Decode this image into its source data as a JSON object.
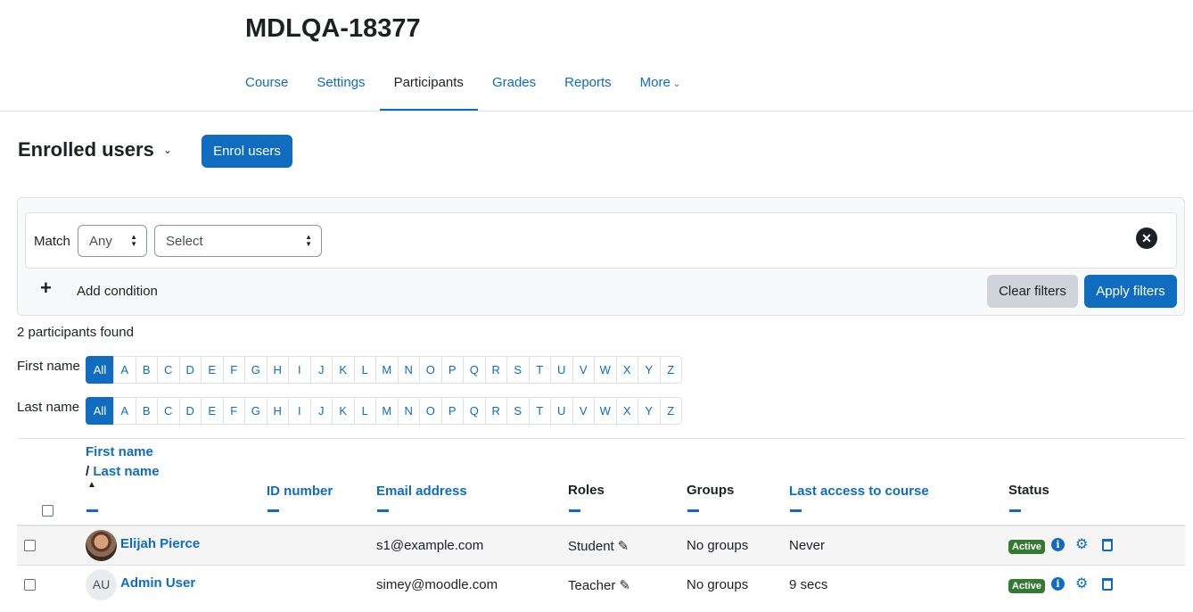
{
  "course": {
    "title": "MDLQA-18377"
  },
  "tabs": [
    {
      "label": "Course"
    },
    {
      "label": "Settings"
    },
    {
      "label": "Participants"
    },
    {
      "label": "Grades"
    },
    {
      "label": "Reports"
    },
    {
      "label": "More"
    }
  ],
  "page": {
    "heading": "Enrolled users",
    "enrol_button": "Enrol users",
    "count_text": "2 participants found"
  },
  "filter": {
    "match_label": "Match",
    "match_value": "Any",
    "type_value": "Select",
    "add_condition": "Add condition",
    "clear_label": "Clear filters",
    "apply_label": "Apply filters"
  },
  "initials": {
    "first_label": "First name",
    "last_label": "Last name",
    "letters": [
      "All",
      "A",
      "B",
      "C",
      "D",
      "E",
      "F",
      "G",
      "H",
      "I",
      "J",
      "K",
      "L",
      "M",
      "N",
      "O",
      "P",
      "Q",
      "R",
      "S",
      "T",
      "U",
      "V",
      "W",
      "X",
      "Y",
      "Z"
    ]
  },
  "table": {
    "headers": {
      "first_name": "First name",
      "slash": "/",
      "last_name": "Last name",
      "id_number": "ID number",
      "email": "Email address",
      "roles": "Roles",
      "groups": "Groups",
      "last_access": "Last access to course",
      "status": "Status"
    },
    "rows": [
      {
        "name": "Elijah Pierce",
        "avatar_initials": "",
        "email": "s1@example.com",
        "role": "Student",
        "groups": "No groups",
        "last_access": "Never",
        "status": "Active"
      },
      {
        "name": "Admin User",
        "avatar_initials": "AU",
        "email": "simey@moodle.com",
        "role": "Teacher",
        "groups": "No groups",
        "last_access": "9 secs",
        "status": "Active"
      }
    ]
  },
  "colors": {
    "primary": "#0f6cbf",
    "active_badge": "#357a32"
  }
}
